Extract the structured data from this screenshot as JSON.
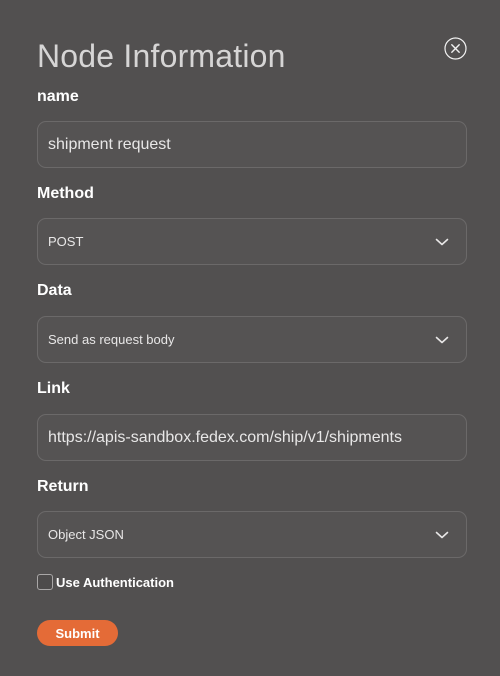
{
  "dialog": {
    "title": "Node Information",
    "close_icon": "close-circle-icon"
  },
  "form": {
    "name": {
      "label": "name",
      "value": "shipment request"
    },
    "method": {
      "label": "Method",
      "selected": "POST",
      "icon": "chevron-down-icon"
    },
    "data": {
      "label": "Data",
      "selected": "Send as request body",
      "icon": "chevron-down-icon"
    },
    "link": {
      "label": "Link",
      "value": "https://apis-sandbox.fedex.com/ship/v1/shipments"
    },
    "return": {
      "label": "Return",
      "selected": "Object JSON",
      "icon": "chevron-down-icon"
    },
    "auth": {
      "label": "Use Authentication",
      "checked": false
    },
    "submit_label": "Submit"
  },
  "colors": {
    "background": "#525050",
    "accent": "#e46b37"
  }
}
